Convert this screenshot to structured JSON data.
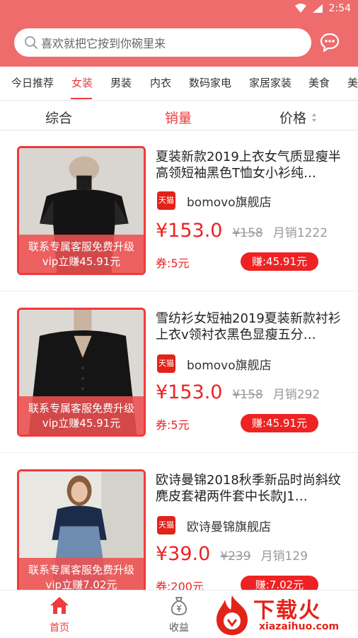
{
  "status_bar": {
    "time": "2:54"
  },
  "search": {
    "placeholder": "喜欢就把它按到你碗里来"
  },
  "categories": [
    {
      "label": "今日推荐"
    },
    {
      "label": "女装"
    },
    {
      "label": "男装"
    },
    {
      "label": "内衣"
    },
    {
      "label": "数码家电"
    },
    {
      "label": "家居家装"
    },
    {
      "label": "美食"
    },
    {
      "label": "美"
    }
  ],
  "sort": {
    "overall": "综合",
    "sales": "销量",
    "price": "价格"
  },
  "products": [
    {
      "title": "夏装新款2019上衣女气质显瘦半高领短袖黑色T恤女小衫纯…",
      "shop": "bomovo旗舰店",
      "badge": "天猫",
      "price": "¥153.0",
      "old_price": "¥158",
      "sales": "月销1222",
      "coupon": "券:5元",
      "earn": "赚:45.91元",
      "banner1": "联系专属客服免费升级",
      "banner2": "vip立赚45.91元"
    },
    {
      "title": "雪纺衫女短袖2019夏装新款衬衫上衣v领衬衣黑色显瘦五分…",
      "shop": "bomovo旗舰店",
      "badge": "天猫",
      "price": "¥153.0",
      "old_price": "¥158",
      "sales": "月销292",
      "coupon": "券:5元",
      "earn": "赚:45.91元",
      "banner1": "联系专属客服免费升级",
      "banner2": "vip立赚45.91元"
    },
    {
      "title": "欧诗曼锦2018秋季新品时尚斜纹麂皮套裙两件套中长款J1…",
      "shop": "欧诗曼锦旗舰店",
      "badge": "天猫",
      "price": "¥39.0",
      "old_price": "¥239",
      "sales": "月销129",
      "coupon": "券:200元",
      "earn": "赚:7.02元",
      "banner1": "联系专属客服免费升级",
      "banner2": "vip立赚7.02元"
    }
  ],
  "bottom_nav": {
    "home": "首页",
    "earnings": "收益"
  },
  "watermark": {
    "text": "下载火",
    "sub": "xiazaihuo.com"
  },
  "colors": {
    "brand": "#ef6c6c",
    "accent": "#ee2222"
  }
}
